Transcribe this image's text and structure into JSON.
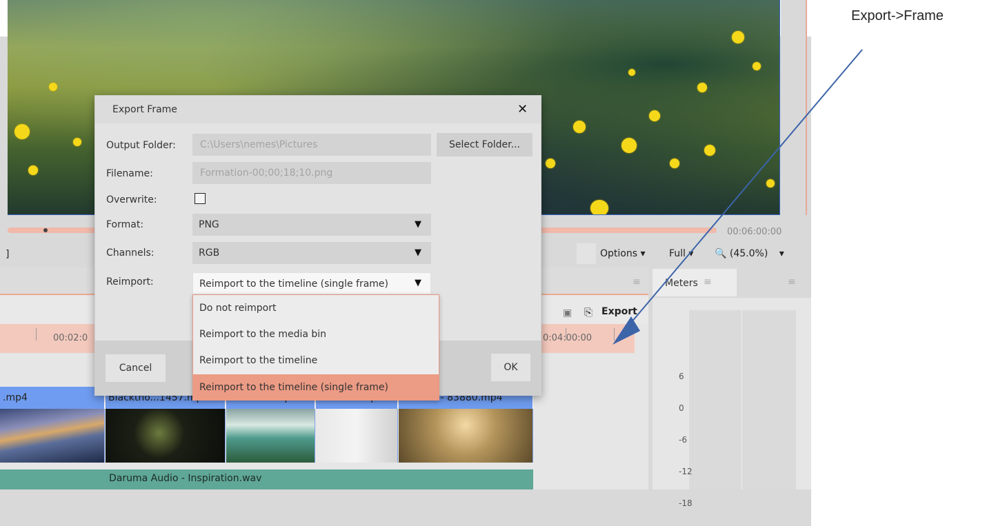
{
  "annotation": {
    "label": "Export->Frame"
  },
  "preview": {
    "end_timecode": "00:06:00:00"
  },
  "controls": {
    "marker_glyph": "]",
    "options_label": "Options ▾",
    "full_label": "Full ▾",
    "zoom_label": "(45.0%)",
    "zoom_arrow": "▾"
  },
  "timeline": {
    "export_label": "Export",
    "ruler": [
      "00:02:0",
      "0:04:00:00"
    ],
    "clips": [
      ".mp4",
      "Blacktho...1457.mp4",
      "Water...2.mp4",
      "Woma....mp4",
      "Sunrise - 83880.mp4"
    ],
    "audio_clip": "Daruma Audio - Inspiration.wav"
  },
  "meters": {
    "tab_label": "Meters",
    "ticks": [
      "6",
      "0",
      "-6",
      "-12",
      "-18"
    ]
  },
  "dialog": {
    "title": "Export Frame",
    "close_glyph": "✕",
    "output_folder_label": "Output Folder:",
    "output_folder_value": "C:\\Users\\nemes\\Pictures",
    "select_folder_label": "Select Folder...",
    "filename_label": "Filename:",
    "filename_value": "Formation-00;00;18;10.png",
    "overwrite_label": "Overwrite:",
    "overwrite_checked": false,
    "format_label": "Format:",
    "format_value": "PNG",
    "channels_label": "Channels:",
    "channels_value": "RGB",
    "reimport_label": "Reimport:",
    "reimport_value": "Reimport to the timeline (single frame)",
    "cancel_label": "Cancel",
    "ok_label": "OK"
  },
  "reimport_options": [
    "Do not reimport",
    "Reimport to the media bin",
    "Reimport to the timeline",
    "Reimport to the timeline (single frame)"
  ],
  "colors": {
    "accent": "#ec9b85",
    "clip_blue": "#6f9cf0",
    "audio_green": "#5fa796",
    "arrow": "#3c64a8"
  }
}
